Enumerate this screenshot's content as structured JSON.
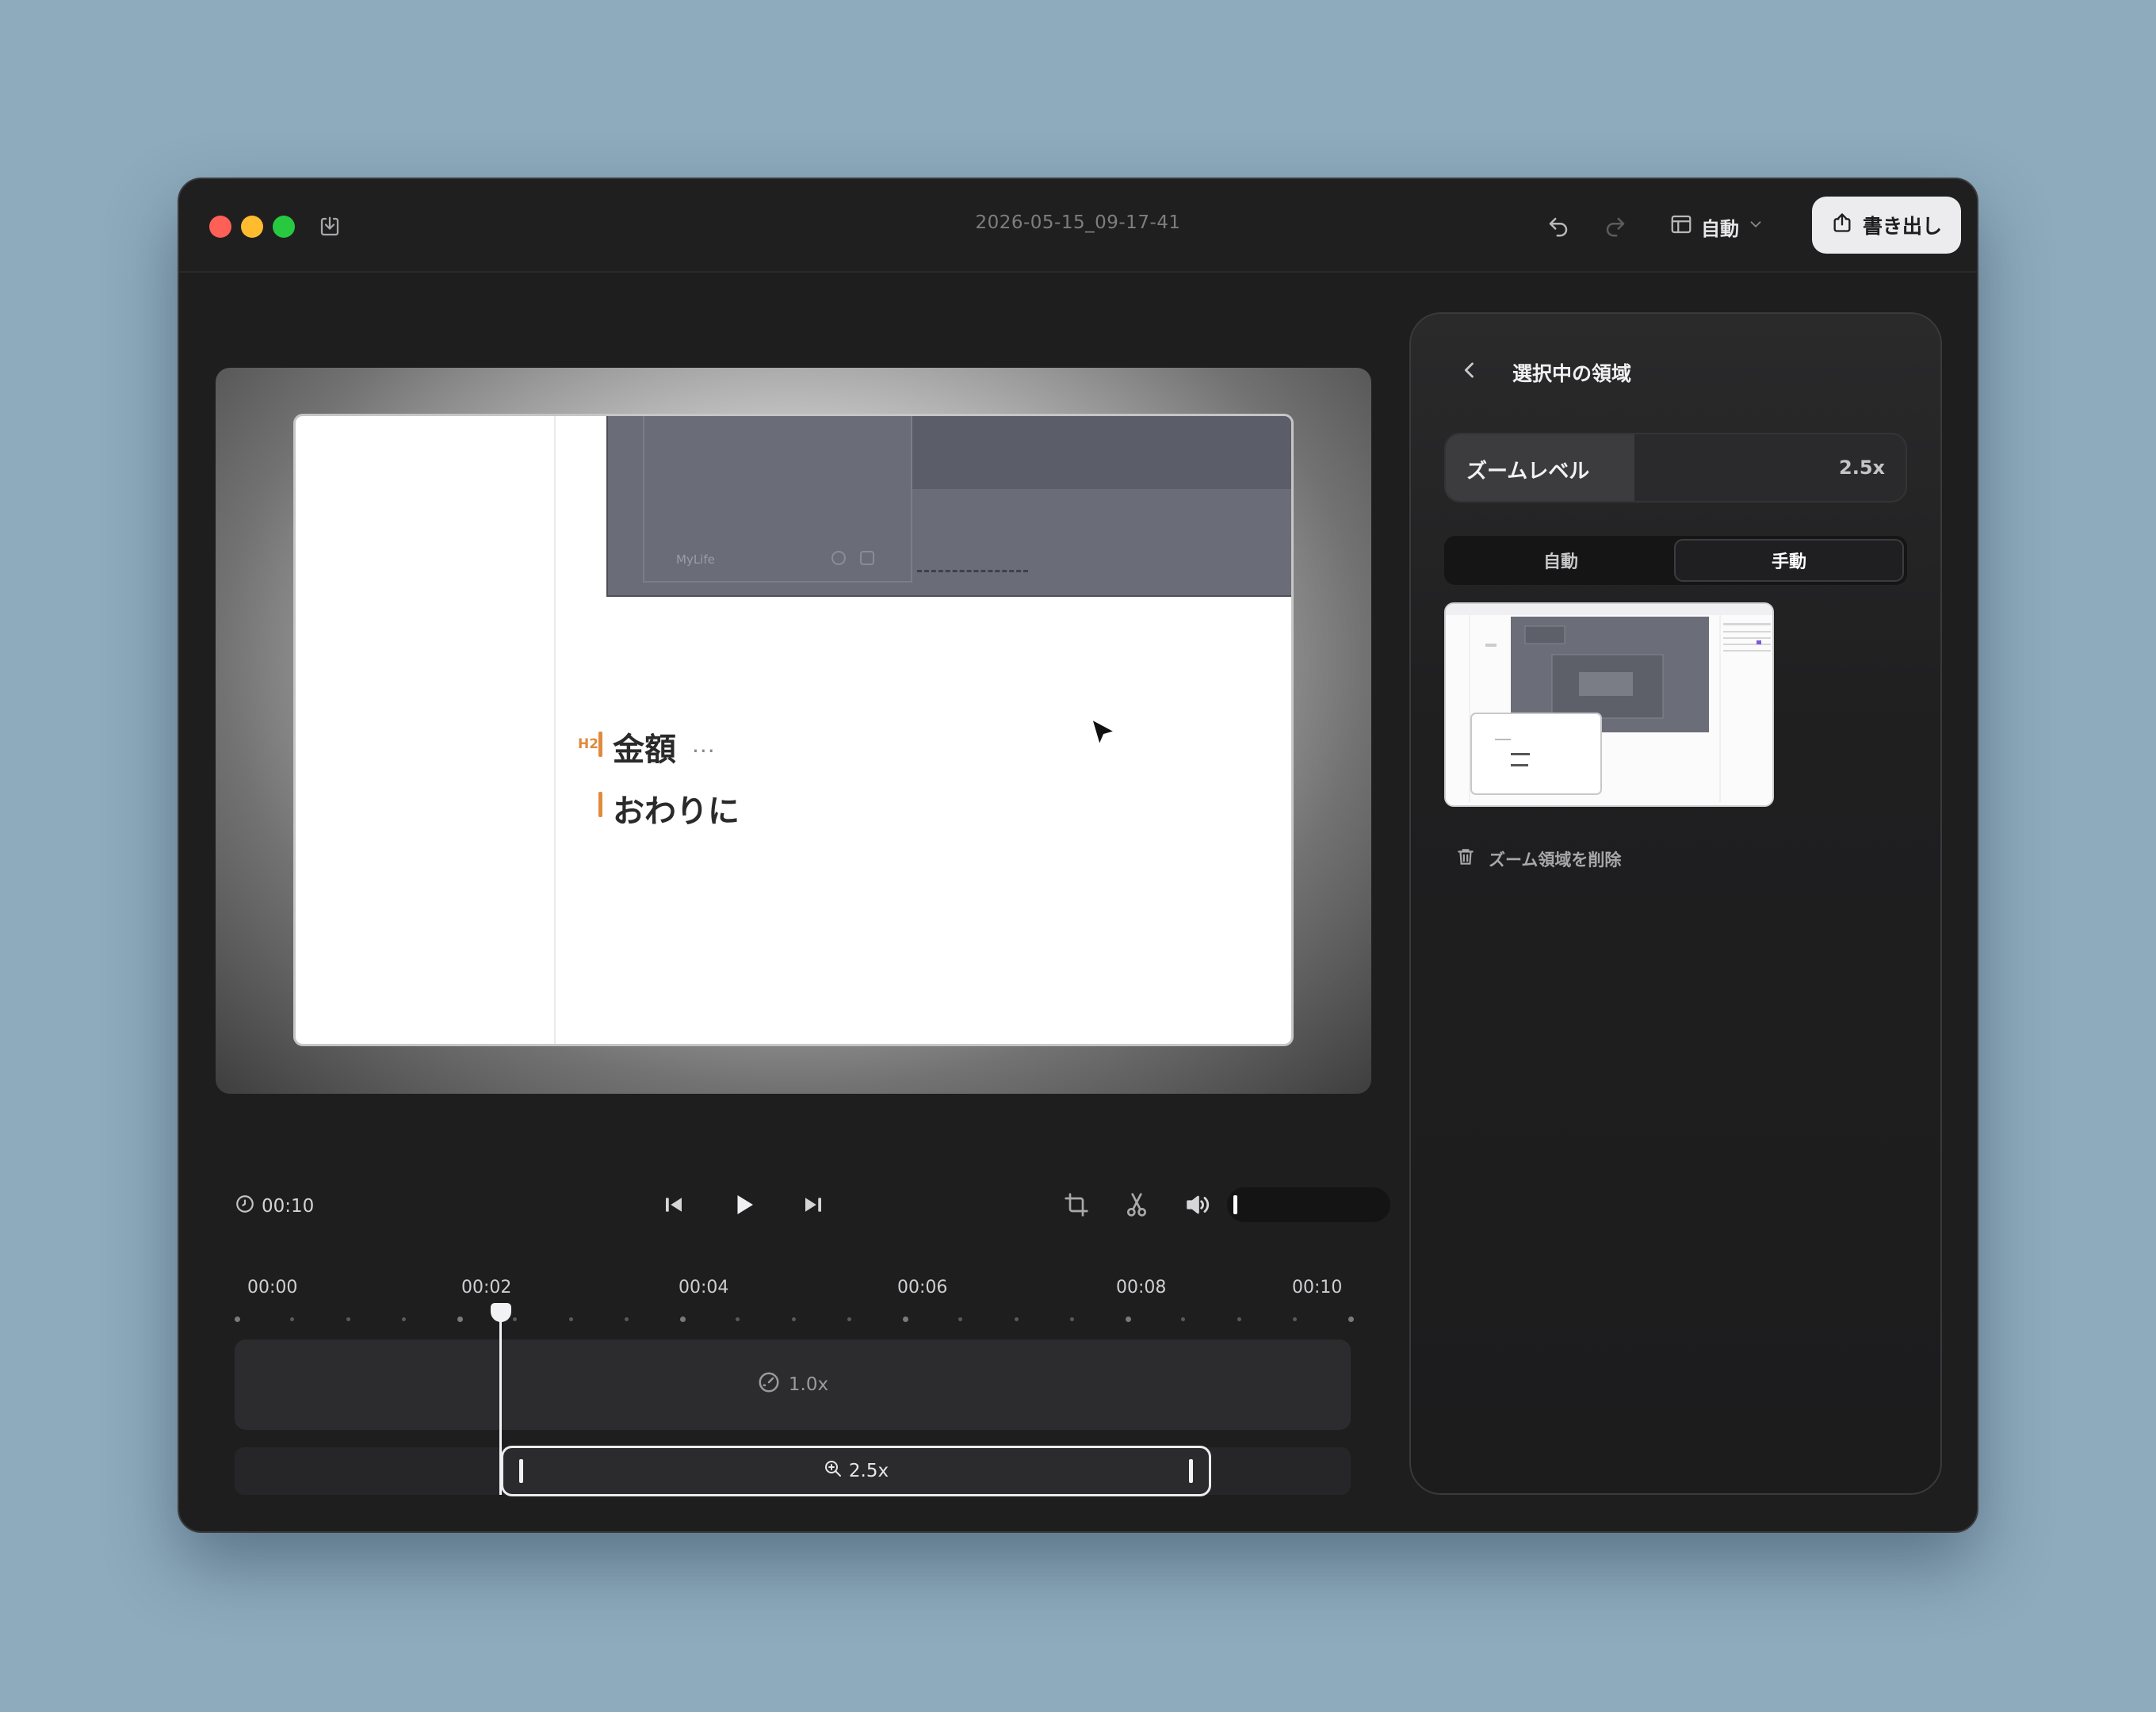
{
  "titlebar": {
    "title": "2026-05-15_09-17-41",
    "layout_label": "自動",
    "export_label": "書き出し"
  },
  "preview": {
    "app_name": "MyLife",
    "h2_tag": "H2",
    "heading_1": "金額",
    "heading_1_more": "...",
    "heading_2": "おわりに"
  },
  "player": {
    "duration": "00:10"
  },
  "timeline": {
    "ticks": [
      "00:00",
      "00:02",
      "00:04",
      "00:06",
      "00:08",
      "00:10"
    ],
    "speed_label": "1.0x",
    "zoom_label": "2.5x",
    "playhead_time_seconds": 2.1,
    "zoom_segment": {
      "start_seconds": 2.1,
      "end_seconds": 8.9
    }
  },
  "panel": {
    "title": "選択中の領域",
    "zoom_level_label": "ズームレベル",
    "zoom_level_value": "2.5x",
    "zoom_level_fraction": 0.41,
    "mode_auto": "自動",
    "mode_manual": "手動",
    "active_mode": "手動",
    "delete_label": "ズーム領域を削除"
  },
  "colors": {
    "close": "#fe5f57",
    "minimize": "#febc2e",
    "maximize": "#28c840",
    "accent_heading": "#e08a3c"
  },
  "icons": [
    "save-icon",
    "undo-icon",
    "redo-icon",
    "layout-icon",
    "chevron-down-icon",
    "share-icon",
    "back-icon",
    "clock-icon",
    "skip-back-icon",
    "play-icon",
    "skip-forward-icon",
    "crop-icon",
    "scissors-icon",
    "speaker-icon",
    "speed-icon",
    "zoom-in-icon",
    "trash-icon",
    "cursor-icon"
  ]
}
